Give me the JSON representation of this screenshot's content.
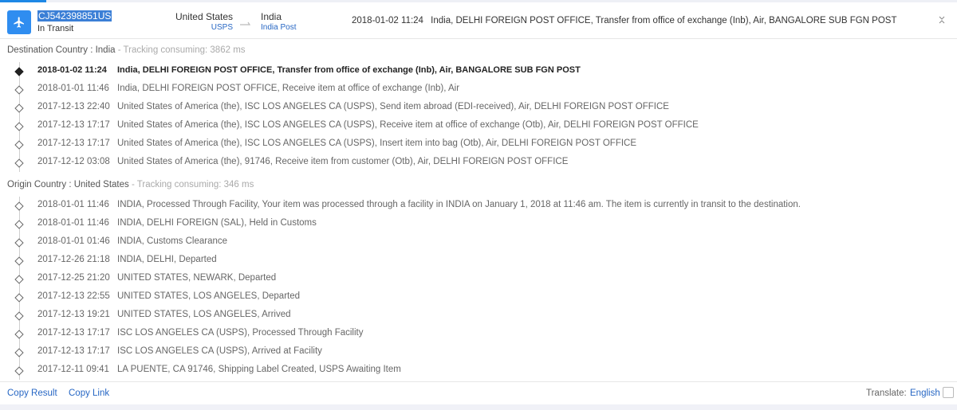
{
  "header": {
    "tracking_number": "CJ542398851US",
    "status": "In Transit",
    "origin_country": "United States",
    "origin_carrier": "USPS",
    "destination_country": "India",
    "destination_carrier": "India Post",
    "latest_time": "2018-01-02 11:24",
    "latest_desc": "India, DELHI FOREIGN POST OFFICE, Transfer from office of exchange (Inb), Air, BANGALORE SUB FGN POST",
    "icons": {
      "status": "airplane-icon",
      "route": "route-arrow-icon",
      "collapse": "collapse-icon"
    }
  },
  "destination": {
    "label": "Destination Country : India",
    "consuming": " - Tracking consuming: 3862 ms",
    "events": [
      {
        "time": "2018-01-02 11:24",
        "desc": "India, DELHI FOREIGN POST OFFICE, Transfer from office of exchange (Inb), Air, BANGALORE SUB FGN POST"
      },
      {
        "time": "2018-01-01 11:46",
        "desc": "India, DELHI FOREIGN POST OFFICE, Receive item at office of exchange (Inb), Air"
      },
      {
        "time": "2017-12-13 22:40",
        "desc": "United States of America (the), ISC LOS ANGELES CA (USPS), Send item abroad (EDI-received), Air, DELHI FOREIGN POST OFFICE"
      },
      {
        "time": "2017-12-13 17:17",
        "desc": "United States of America (the), ISC LOS ANGELES CA (USPS), Receive item at office of exchange (Otb), Air, DELHI FOREIGN POST OFFICE"
      },
      {
        "time": "2017-12-13 17:17",
        "desc": "United States of America (the), ISC LOS ANGELES CA (USPS), Insert item into bag (Otb), Air, DELHI FOREIGN POST OFFICE"
      },
      {
        "time": "2017-12-12 03:08",
        "desc": "United States of America (the), 91746, Receive item from customer (Otb), Air, DELHI FOREIGN POST OFFICE"
      }
    ]
  },
  "origin": {
    "label": "Origin Country : United States",
    "consuming": " - Tracking consuming: 346 ms",
    "events": [
      {
        "time": "2018-01-01 11:46",
        "desc": "INDIA, Processed Through Facility, Your item was processed through a facility in INDIA on January 1, 2018 at 11:46 am. The item is currently in transit to the destination."
      },
      {
        "time": "2018-01-01 11:46",
        "desc": "INDIA, DELHI FOREIGN (SAL), Held in Customs"
      },
      {
        "time": "2018-01-01 01:46",
        "desc": "INDIA, Customs Clearance"
      },
      {
        "time": "2017-12-26 21:18",
        "desc": "INDIA, DELHI, Departed"
      },
      {
        "time": "2017-12-25 21:20",
        "desc": "UNITED STATES, NEWARK, Departed"
      },
      {
        "time": "2017-12-13 22:55",
        "desc": "UNITED STATES, LOS ANGELES, Departed"
      },
      {
        "time": "2017-12-13 19:21",
        "desc": "UNITED STATES, LOS ANGELES, Arrived"
      },
      {
        "time": "2017-12-13 17:17",
        "desc": "ISC LOS ANGELES CA (USPS), Processed Through Facility"
      },
      {
        "time": "2017-12-13 17:17",
        "desc": "ISC LOS ANGELES CA (USPS), Arrived at Facility"
      },
      {
        "time": "2017-12-11 09:41",
        "desc": "LA PUENTE, CA 91746, Shipping Label Created, USPS Awaiting Item"
      }
    ]
  },
  "footer": {
    "copy_result": "Copy Result",
    "copy_link": "Copy Link",
    "translate_label": "Translate:",
    "translate_value": "English"
  },
  "colors": {
    "accent": "#2f8df0",
    "link": "#2767c4"
  }
}
